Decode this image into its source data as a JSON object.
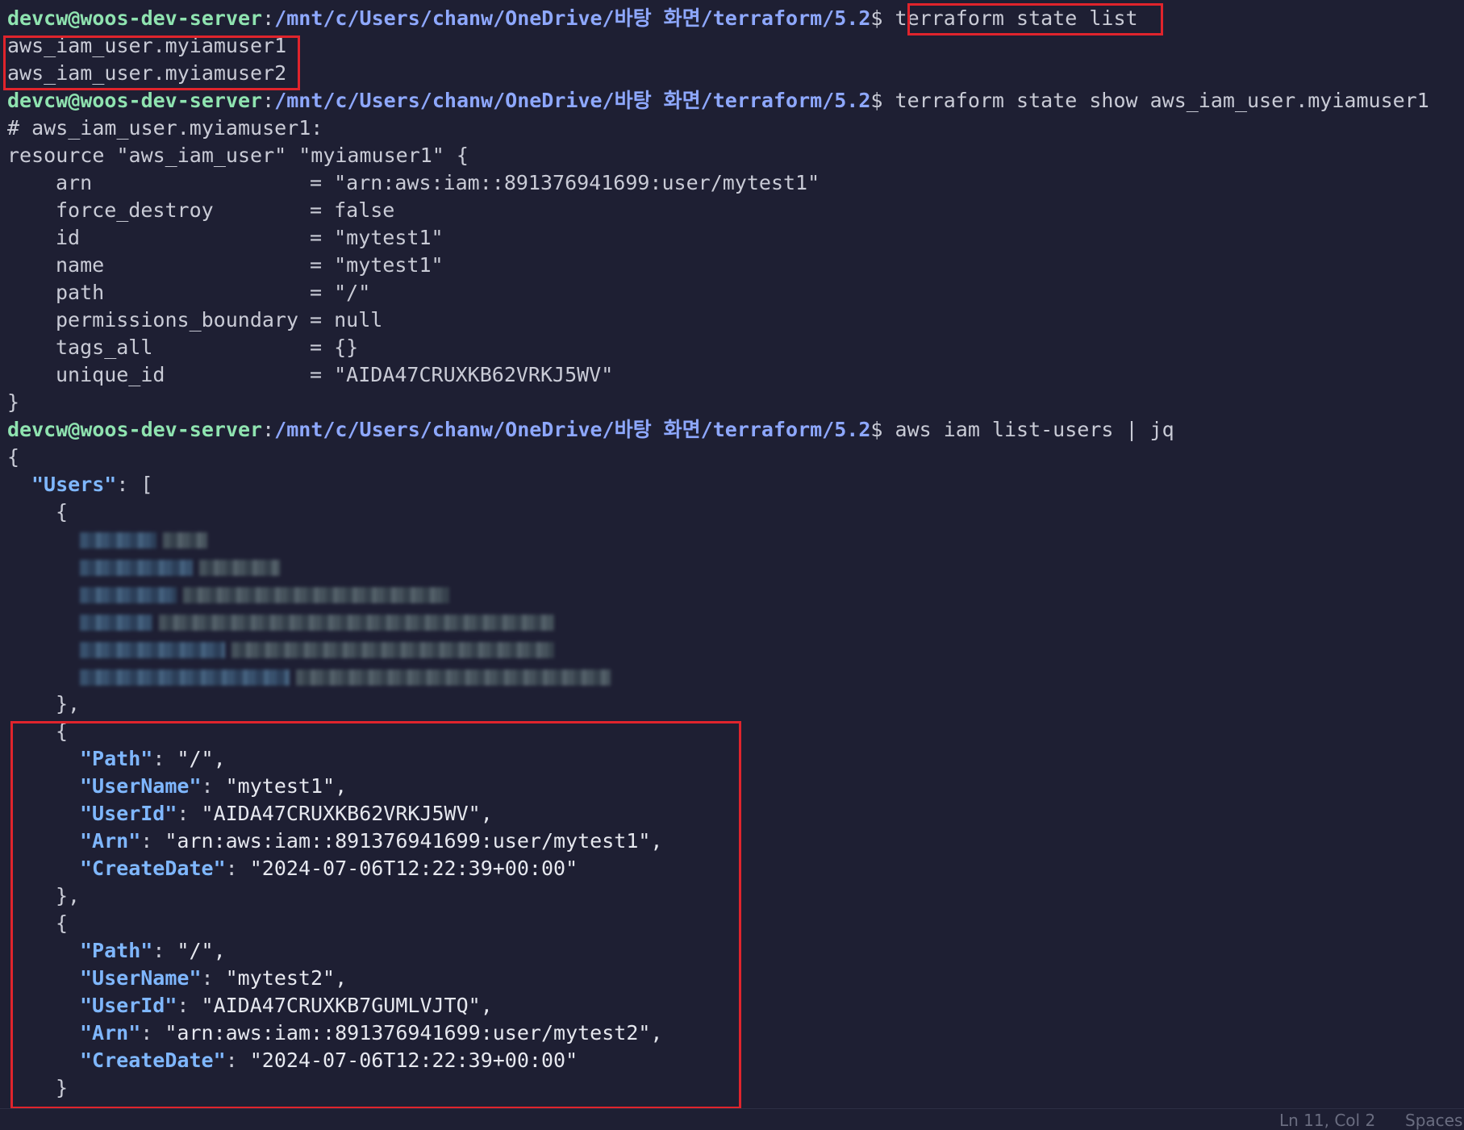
{
  "prompt": {
    "user": "devcw",
    "at": "@",
    "host": "woos-dev-server",
    "sep": ":",
    "cwd": "/mnt/c/Users/chanw/OneDrive/바탕 화면/terraform/5.2",
    "dollar": "$"
  },
  "commands": {
    "state_list": "terraform state list",
    "state_show": "terraform state show aws_iam_user.myiamuser1",
    "list_users": "aws iam list-users | jq"
  },
  "state_list_output": [
    "aws_iam_user.myiamuser1",
    "aws_iam_user.myiamuser2"
  ],
  "state_show_output": {
    "comment": "# aws_iam_user.myiamuser1:",
    "header": "resource \"aws_iam_user\" \"myiamuser1\" {",
    "attributes": [
      {
        "name": "arn",
        "value": "= \"arn:aws:iam::891376941699:user/mytest1\""
      },
      {
        "name": "force_destroy",
        "value": "= false"
      },
      {
        "name": "id",
        "value": "= \"mytest1\""
      },
      {
        "name": "name",
        "value": "= \"mytest1\""
      },
      {
        "name": "path",
        "value": "= \"/\""
      },
      {
        "name": "permissions_boundary",
        "value": "= null"
      },
      {
        "name": "tags_all",
        "value": "= {}"
      },
      {
        "name": "unique_id",
        "value": "= \"AIDA47CRUXKB62VRKJ5WV\""
      }
    ],
    "footer": "}"
  },
  "json": {
    "open": "{",
    "users_key": "\"Users\"",
    "users_sep": ": [",
    "obj_open": "{",
    "obj_close_comma": "},",
    "obj_close": "}",
    "users": [
      {
        "path_key": "\"Path\"",
        "path_val": "\"/\",",
        "username_key": "\"UserName\"",
        "username_val": "\"mytest1\",",
        "userid_key": "\"UserId\"",
        "userid_val": "\"AIDA47CRUXKB62VRKJ5WV\",",
        "arn_key": "\"Arn\"",
        "arn_val": "\"arn:aws:iam::891376941699:user/mytest1\",",
        "createdate_key": "\"CreateDate\"",
        "createdate_val": "\"2024-07-06T12:22:39+00:00\""
      },
      {
        "path_key": "\"Path\"",
        "path_val": "\"/\",",
        "username_key": "\"UserName\"",
        "username_val": "\"mytest2\",",
        "userid_key": "\"UserId\"",
        "userid_val": "\"AIDA47CRUXKB7GUMLVJTQ\",",
        "arn_key": "\"Arn\"",
        "arn_val": "\"arn:aws:iam::891376941699:user/mytest2\",",
        "createdate_key": "\"CreateDate\"",
        "createdate_val": "\"2024-07-06T12:22:39+00:00\""
      }
    ],
    "colon": ": "
  },
  "status_bar": {
    "position": "Ln 11, Col 2",
    "spaces": "Spaces"
  },
  "colors": {
    "background": "#1e1f33",
    "prompt_user": "#8fe3b0",
    "prompt_path": "#8ea8ff",
    "json_key": "#7fb7ff",
    "highlight": "#e0242c"
  }
}
